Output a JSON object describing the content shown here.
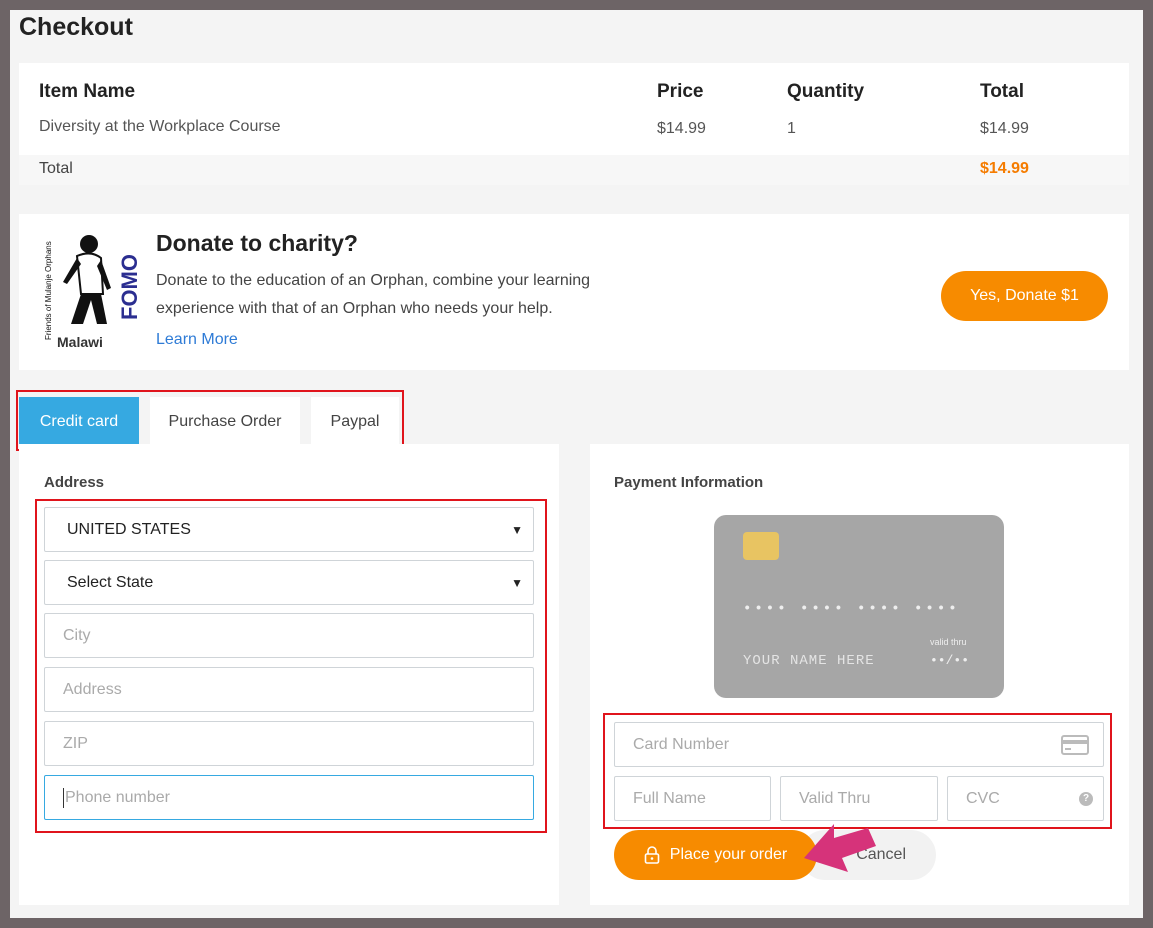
{
  "page_title": "Checkout",
  "order": {
    "headers": {
      "item": "Item Name",
      "price": "Price",
      "quantity": "Quantity",
      "total": "Total"
    },
    "item": {
      "name": "Diversity at the Workplace Course",
      "price": "$14.99",
      "quantity": "1",
      "total": "$14.99"
    },
    "total_label": "Total",
    "total_amount": "$14.99"
  },
  "donate": {
    "logo_title": "FOMO",
    "logo_sub": "Friends of Mulanje Orphans",
    "logo_country": "Malawi",
    "title": "Donate to charity?",
    "description": "Donate to the education of an Orphan, combine your learning experience with that of an Orphan who needs your help.",
    "learn_more": "Learn More",
    "button": "Yes, Donate $1"
  },
  "tabs": [
    {
      "label": "Credit card",
      "active": true
    },
    {
      "label": "Purchase Order",
      "active": false
    },
    {
      "label": "Paypal",
      "active": false
    }
  ],
  "address": {
    "label": "Address",
    "country": "UNITED STATES",
    "state": "Select State",
    "city_placeholder": "City",
    "address_placeholder": "Address",
    "zip_placeholder": "ZIP",
    "phone_placeholder": "Phone number"
  },
  "payment": {
    "label": "Payment Information",
    "card_number_mask": "•••• •••• •••• ••••",
    "card_name_mask": "YOUR NAME HERE",
    "valid_thru_label": "valid thru",
    "valid_thru_mask": "••/••",
    "card_number_placeholder": "Card Number",
    "full_name_placeholder": "Full Name",
    "valid_thru_placeholder": "Valid Thru",
    "cvc_placeholder": "CVC",
    "place_order": "Place your order",
    "cancel": "Cancel"
  },
  "colors": {
    "accent_orange": "#f78b00",
    "tab_active": "#36a9e1",
    "highlight_red": "#e0141c",
    "arrow_pink": "#d6337a"
  }
}
